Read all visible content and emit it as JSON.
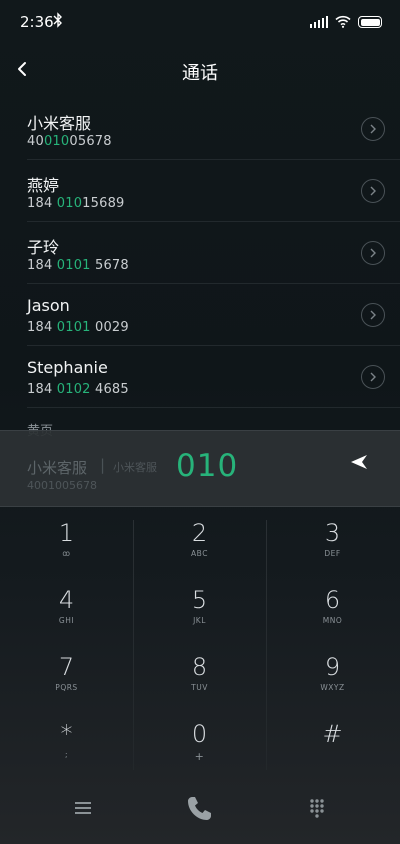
{
  "status": {
    "time": "2:36"
  },
  "header": {
    "title": "通话"
  },
  "contacts": [
    {
      "name": "小米客服",
      "num_pre": "40",
      "num_hl": "010",
      "num_post": "05678"
    },
    {
      "name": "燕婷",
      "num_pre": "184 ",
      "num_hl": "010",
      "num_post": "15689"
    },
    {
      "name": "子玲",
      "num_pre": "184 ",
      "num_hl": "0101",
      "num_post": " 5678"
    },
    {
      "name": "Jason",
      "num_pre": "184 ",
      "num_hl": "0101",
      "num_post": " 0029"
    },
    {
      "name": "Stephanie",
      "num_pre": "184 ",
      "num_hl": "0102",
      "num_post": " 4685"
    }
  ],
  "section_label": "黄页",
  "input": {
    "match_name": "小米客服",
    "match_sep": "|",
    "match_sub": "小米客服",
    "match_num": "4001005678",
    "typed": "010"
  },
  "keys": [
    {
      "digit": "1",
      "letters": "ꝏ"
    },
    {
      "digit": "2",
      "letters": "ABC"
    },
    {
      "digit": "3",
      "letters": "DEF"
    },
    {
      "digit": "4",
      "letters": "GHI"
    },
    {
      "digit": "5",
      "letters": "JKL"
    },
    {
      "digit": "6",
      "letters": "MNO"
    },
    {
      "digit": "7",
      "letters": "PQRS"
    },
    {
      "digit": "8",
      "letters": "TUV"
    },
    {
      "digit": "9",
      "letters": "WXYZ"
    },
    {
      "digit": "*",
      "letters": ";"
    },
    {
      "digit": "0",
      "letters": "+"
    },
    {
      "digit": "#",
      "letters": ""
    }
  ],
  "colors": {
    "accent": "#27b37a",
    "background": "#0d1316"
  },
  "icons": {
    "back": "chevron-left-icon",
    "backspace": "backspace-icon",
    "menu": "menu-icon",
    "call": "phone-icon",
    "dialpad": "dialpad-icon"
  }
}
